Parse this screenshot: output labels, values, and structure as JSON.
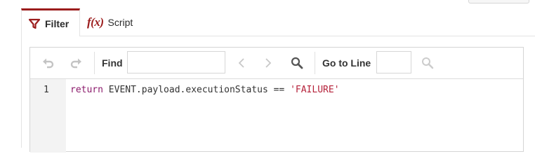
{
  "tabs": [
    {
      "label": "Filter",
      "icon": "funnel-icon",
      "active": true
    },
    {
      "label": "Script",
      "icon_text": "f(x)",
      "active": false
    }
  ],
  "toolbar": {
    "undo_icon": "undo-icon",
    "redo_icon": "redo-icon",
    "find_label": "Find",
    "find_value": "",
    "prev_icon": "chevron-left-icon",
    "next_icon": "chevron-right-icon",
    "search_icon": "search-icon",
    "goto_label": "Go to Line",
    "goto_value": "",
    "goto_search_icon": "search-icon"
  },
  "editor": {
    "line_number": "1",
    "code_keyword": "return",
    "code_middle": " EVENT.payload.executionStatus == ",
    "code_string": "'FAILURE'"
  },
  "colors": {
    "accent": "#9b1c1c",
    "keyword": "#8b1a6b",
    "string": "#b5223a"
  }
}
